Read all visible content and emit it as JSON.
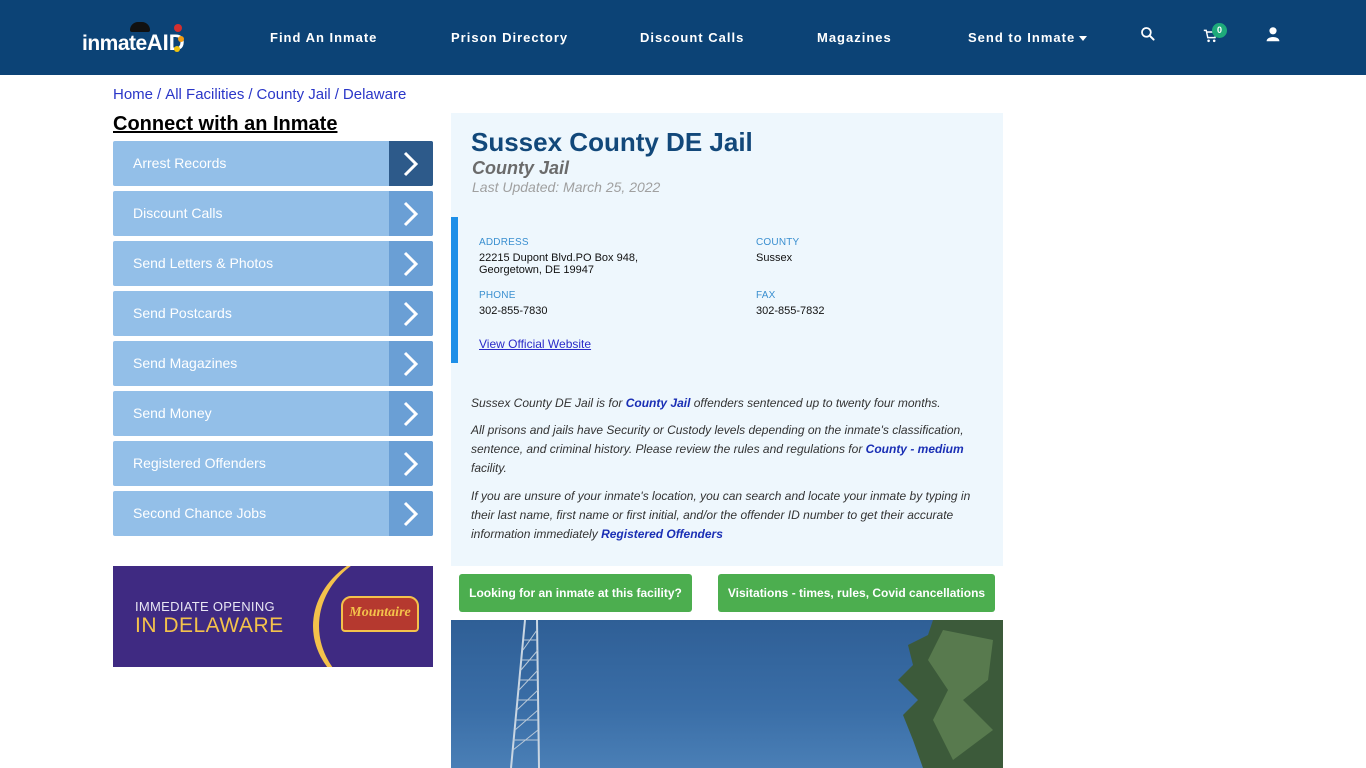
{
  "header": {
    "logo_text": "inmate",
    "logo_accent": "AID",
    "nav": [
      {
        "label": "Find An Inmate"
      },
      {
        "label": "Prison Directory"
      },
      {
        "label": "Discount Calls"
      },
      {
        "label": "Magazines"
      },
      {
        "label": "Send to Inmate"
      }
    ],
    "cart_count": "0",
    "icons": [
      "search-icon",
      "cart-icon",
      "user-icon"
    ]
  },
  "breadcrumb": [
    "Home",
    "All Facilities",
    "County Jail",
    "Delaware"
  ],
  "sidebar": {
    "title": "Connect with an Inmate",
    "items": [
      {
        "label": "Arrest Records"
      },
      {
        "label": "Discount Calls"
      },
      {
        "label": "Send Letters & Photos"
      },
      {
        "label": "Send Postcards"
      },
      {
        "label": "Send Magazines"
      },
      {
        "label": "Send Money"
      },
      {
        "label": "Registered Offenders"
      },
      {
        "label": "Second Chance Jobs"
      }
    ],
    "ad": {
      "line1": "IMMEDIATE OPENING",
      "line2": "IN DELAWARE",
      "brand": "Mountaire"
    }
  },
  "facility": {
    "name": "Sussex County DE Jail",
    "type": "County Jail",
    "last_updated": "Last Updated: March 25, 2022",
    "address_label": "ADDRESS",
    "address_line1": "22215 Dupont Blvd.PO Box 948,",
    "address_line2": "Georgetown, DE 19947",
    "county_label": "COUNTY",
    "county": "Sussex",
    "phone_label": "PHONE",
    "phone": "302-855-7830",
    "fax_label": "FAX",
    "fax": "302-855-7832",
    "website_link": "View Official Website",
    "desc1_pre": "Sussex County DE Jail is for ",
    "desc1_link": "County Jail",
    "desc1_post": " offenders sentenced up to twenty four months.",
    "desc2_pre": "All prisons and jails have Security or Custody levels depending on the inmate's classification, sentence, and criminal history. Please review the rules and regulations for ",
    "desc2_link": "County - medium",
    "desc2_post": " facility.",
    "desc3_pre": "If you are unsure of your inmate's location, you can search and locate your inmate by typing in their last name, first name or first initial, and/or the offender ID number to get their accurate information immediately ",
    "desc3_link": "Registered Offenders"
  },
  "buttons": {
    "looking": "Looking for an inmate at this facility?",
    "visitations": "Visitations - times, rules, Covid cancellations"
  },
  "colors": {
    "navbar": "#0c4376",
    "sidebar_item": "#93bfe8",
    "sidebar_arrow": "#6a9fd5",
    "accent_green": "#4cae4f",
    "title_blue": "#12487a"
  }
}
